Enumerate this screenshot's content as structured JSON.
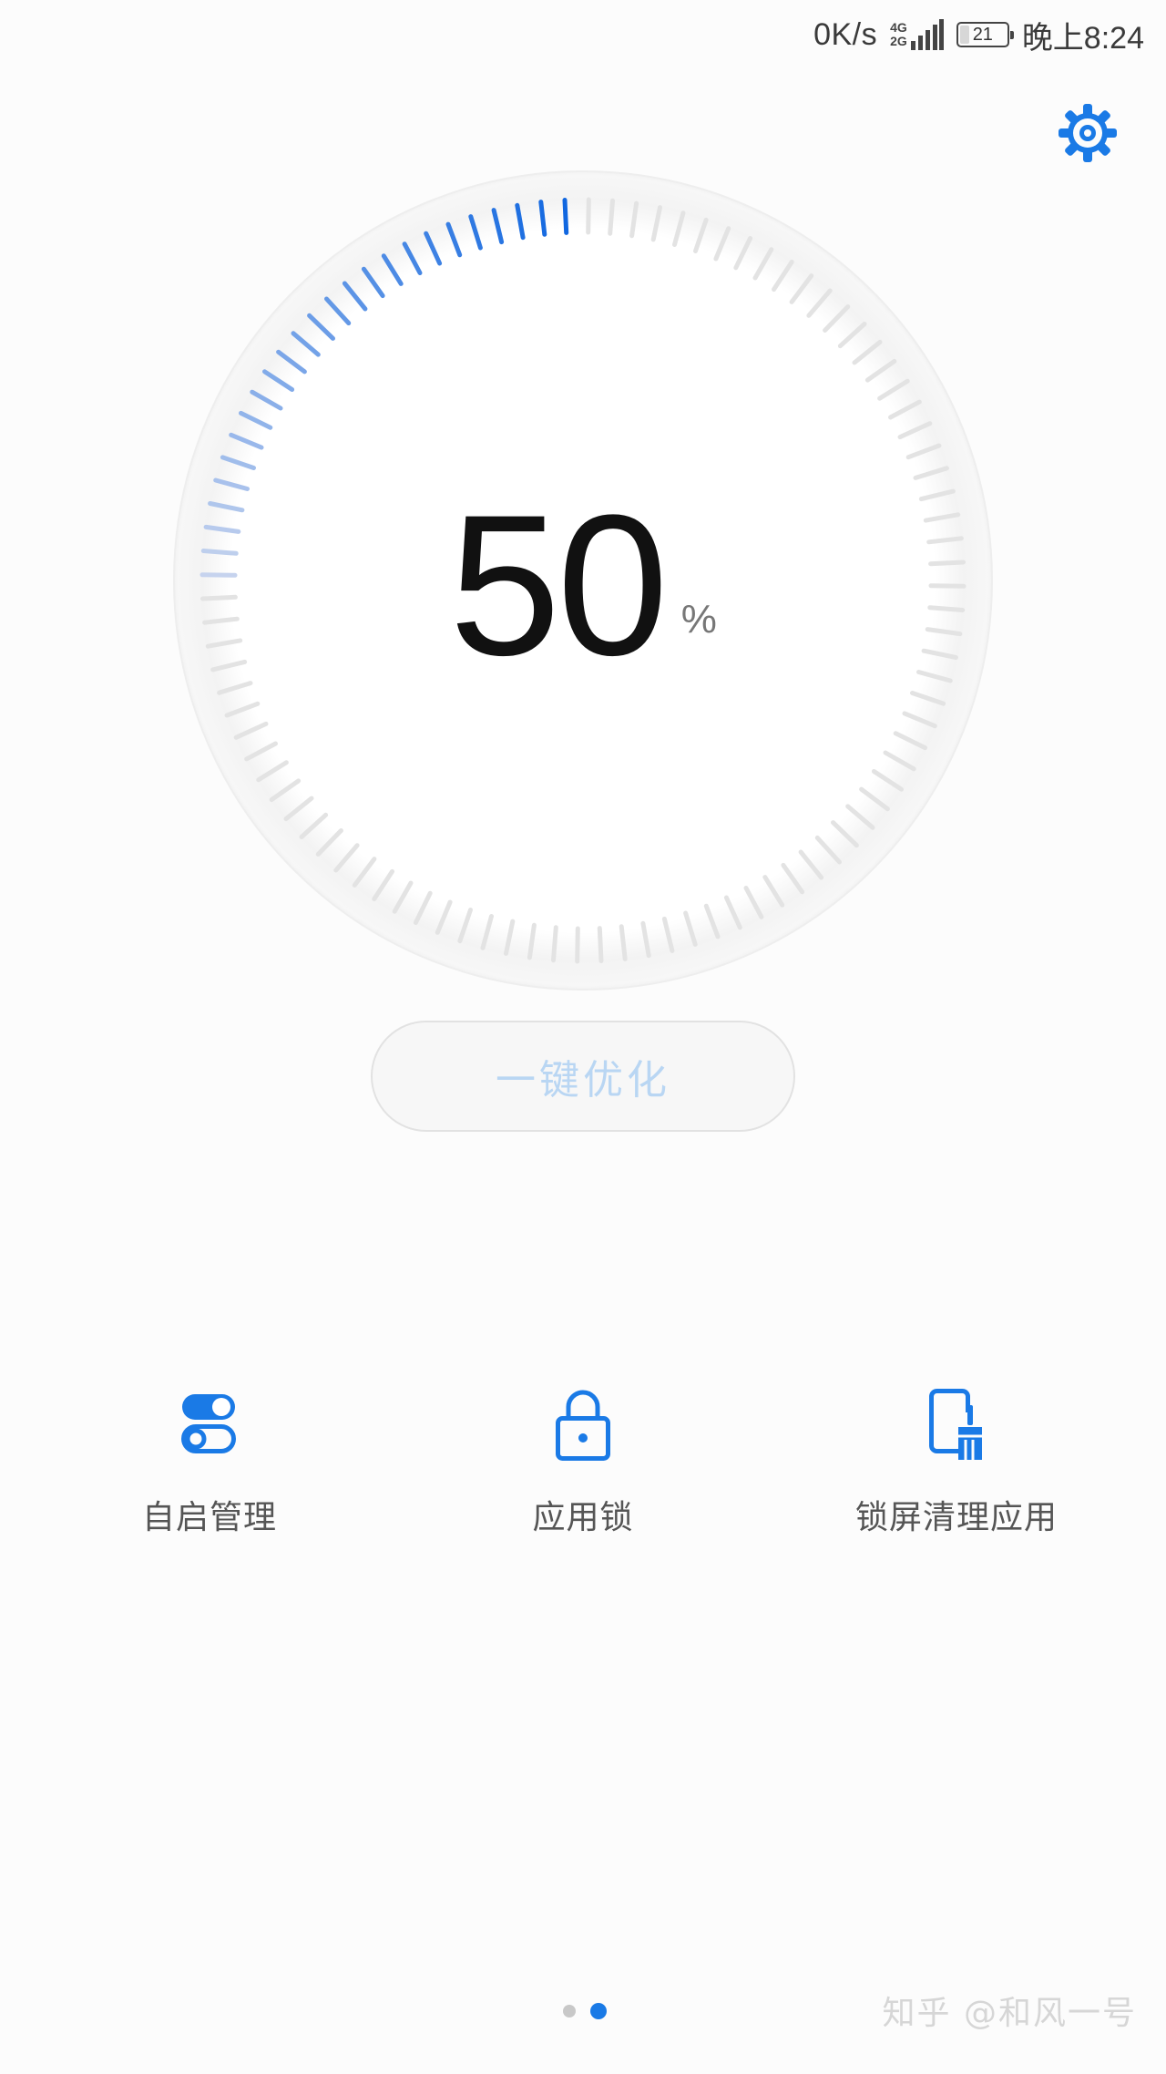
{
  "status_bar": {
    "net_speed": "0K/s",
    "net_type_top": "4G",
    "net_type_bottom": "2G",
    "battery_level": "21",
    "battery_fraction": 0.21,
    "time": "晚上8:24"
  },
  "settings": {
    "icon": "gear-icon"
  },
  "gauge": {
    "value": "50",
    "unit": "%",
    "progress_fraction": 0.5,
    "colors": {
      "active_start": "#c6d3ee",
      "active_end": "#1167e0",
      "inactive": "#e3e3e3"
    }
  },
  "optimize_button": {
    "label": "一键优化"
  },
  "tools": [
    {
      "label": "自启管理",
      "icon": "toggle-switches-icon"
    },
    {
      "label": "应用锁",
      "icon": "lock-icon"
    },
    {
      "label": "锁屏清理应用",
      "icon": "phone-broom-icon"
    }
  ],
  "pager": {
    "count": 2,
    "active": 1
  },
  "watermark": "知乎 @和风一号",
  "accent_color": "#1a7ae6"
}
